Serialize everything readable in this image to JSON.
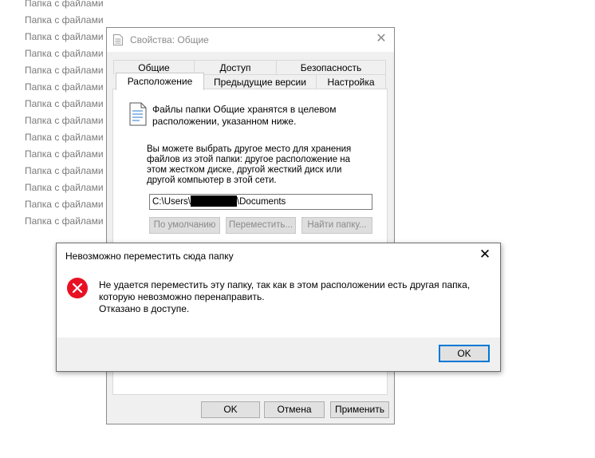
{
  "background_list": {
    "items": [
      "Папка с файлами",
      "Папка с файлами",
      "Папка с файлами",
      "Папка с файлами",
      "Папка с файлами",
      "Папка с файлами",
      "Папка с файлами",
      "Папка с файлами",
      "Папка с файлами",
      "Папка с файлами",
      "Папка с файлами",
      "Папка с файлами",
      "Папка с файлами",
      "Папка с файлами"
    ]
  },
  "properties_dialog": {
    "title": "Свойства: Общие",
    "close_glyph": "✕",
    "tabs_row1": [
      "Общие",
      "Доступ",
      "Безопасность"
    ],
    "tabs_row2": [
      "Расположение",
      "Предыдущие версии",
      "Настройка"
    ],
    "active_tab": "Расположение",
    "info_text": "Файлы папки Общие хранятся в целевом расположении, указанном ниже.",
    "help_text": "Вы можете выбрать другое место для хранения файлов из этой папки: другое расположение на этом жестком диске, другой жесткий диск или другой компьютер в этой сети.",
    "path_prefix": "C:\\Users\\",
    "path_suffix": "\\Documents",
    "buttons": {
      "default": "По умолчанию",
      "move": "Переместить...",
      "find": "Найти папку..."
    },
    "footer": {
      "ok": "OK",
      "cancel": "Отмена",
      "apply": "Применить"
    }
  },
  "error_dialog": {
    "title": "Невозможно переместить сюда папку",
    "close_glyph": "✕",
    "message_line1": "Не удается переместить эту папку, так как в этом расположении есть другая папка,",
    "message_line2": "которую невозможно перенаправить.",
    "message_line3": "Отказано в доступе.",
    "ok": "OK",
    "icon": "error-icon",
    "icon_color": "#e81123"
  }
}
